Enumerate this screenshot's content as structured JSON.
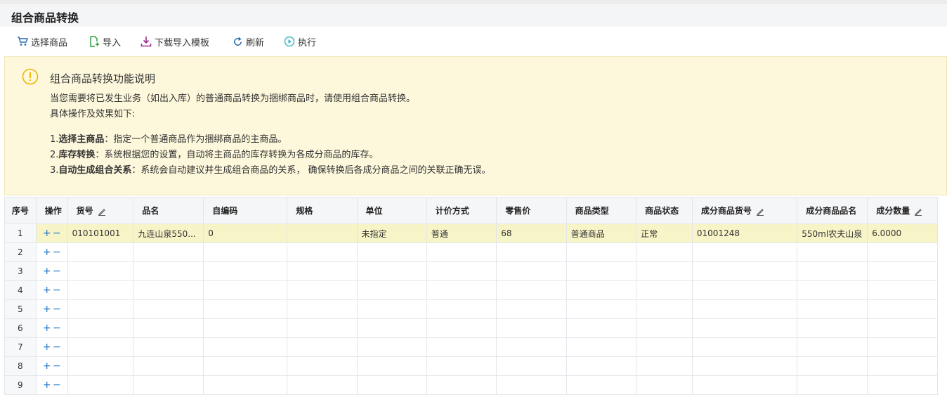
{
  "page": {
    "title": "组合商品转换"
  },
  "toolbar": [
    {
      "label": "选择商品",
      "icon": "cart-icon"
    },
    {
      "label": "导入",
      "icon": "import-icon"
    },
    {
      "label": "下载导入模板",
      "icon": "download-icon"
    },
    {
      "label": "刷新",
      "icon": "refresh-icon"
    },
    {
      "label": "执行",
      "icon": "play-icon"
    }
  ],
  "notice": {
    "title": "组合商品转换功能说明",
    "line1": "当您需要将已发生业务（如出入库）的普通商品转换为捆绑商品时，请使用组合商品转换。",
    "line2": "具体操作及效果如下:",
    "item1_prefix": "1.",
    "item1_bold": "选择主商品",
    "item1_text": "：指定一个普通商品作为捆绑商品的主商品。",
    "item2_prefix": "2.",
    "item2_bold": "库存转换",
    "item2_text": "：系统根据您的设置，自动将主商品的库存转换为各成分商品的库存。",
    "item3_prefix": "3.",
    "item3_bold": "自动生成组合关系",
    "item3_text": "：系统会自动建议并生成组合商品的关系， 确保转换后各成分商品之间的关联正确无误。"
  },
  "table": {
    "columns": [
      "序号",
      "操作",
      "货号",
      "品名",
      "自编码",
      "规格",
      "单位",
      "计价方式",
      "零售价",
      "商品类型",
      "商品状态",
      "成分商品货号",
      "成分商品品名",
      "成分数量"
    ],
    "plus": "+",
    "minus": "−",
    "rows": [
      {
        "seq": "1",
        "cells": [
          "010101001",
          "九连山泉550...",
          "0",
          "",
          "未指定",
          "普通",
          "68",
          "普通商品",
          "正常",
          "01001248",
          "550ml农夫山泉",
          "6.0000"
        ]
      },
      {
        "seq": "2",
        "cells": [
          "",
          "",
          "",
          "",
          "",
          "",
          "",
          "",
          "",
          "",
          "",
          ""
        ]
      },
      {
        "seq": "3",
        "cells": [
          "",
          "",
          "",
          "",
          "",
          "",
          "",
          "",
          "",
          "",
          "",
          ""
        ]
      },
      {
        "seq": "4",
        "cells": [
          "",
          "",
          "",
          "",
          "",
          "",
          "",
          "",
          "",
          "",
          "",
          ""
        ]
      },
      {
        "seq": "5",
        "cells": [
          "",
          "",
          "",
          "",
          "",
          "",
          "",
          "",
          "",
          "",
          "",
          ""
        ]
      },
      {
        "seq": "6",
        "cells": [
          "",
          "",
          "",
          "",
          "",
          "",
          "",
          "",
          "",
          "",
          "",
          ""
        ]
      },
      {
        "seq": "7",
        "cells": [
          "",
          "",
          "",
          "",
          "",
          "",
          "",
          "",
          "",
          "",
          "",
          ""
        ]
      },
      {
        "seq": "8",
        "cells": [
          "",
          "",
          "",
          "",
          "",
          "",
          "",
          "",
          "",
          "",
          "",
          ""
        ]
      },
      {
        "seq": "9",
        "cells": [
          "",
          "",
          "",
          "",
          "",
          "",
          "",
          "",
          "",
          "",
          "",
          ""
        ]
      }
    ]
  },
  "colors": {
    "accent": "#1a73c8",
    "notice_bg": "#fdf8dc",
    "selected_row": "#f7f4c7",
    "warn": "#f0b400"
  }
}
